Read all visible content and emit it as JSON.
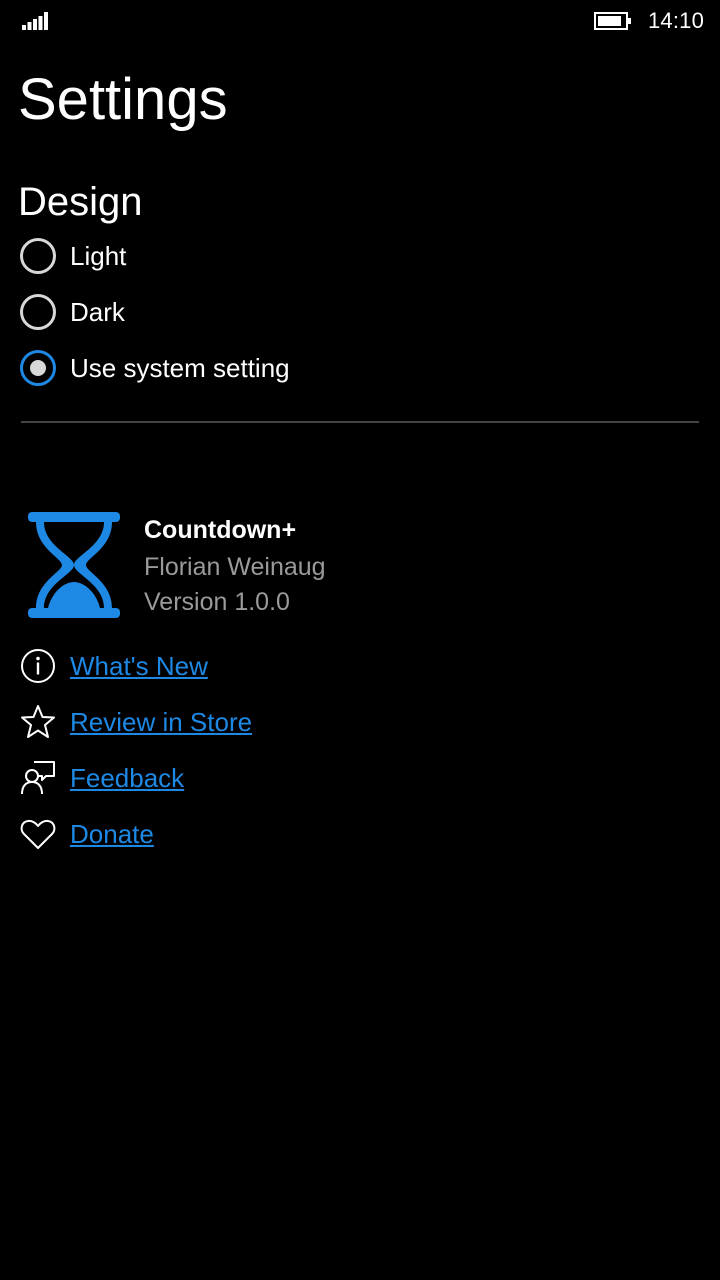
{
  "status_bar": {
    "time": "14:10"
  },
  "page": {
    "title": "Settings"
  },
  "design": {
    "section_title": "Design",
    "options": [
      {
        "label": "Light",
        "selected": false
      },
      {
        "label": "Dark",
        "selected": false
      },
      {
        "label": "Use system setting",
        "selected": true
      }
    ]
  },
  "about": {
    "app_name": "Countdown+",
    "author": "Florian Weinaug",
    "version": "Version 1.0.0"
  },
  "links": [
    {
      "label": "What's New",
      "icon": "info-icon"
    },
    {
      "label": "Review in Store",
      "icon": "star-icon"
    },
    {
      "label": "Feedback",
      "icon": "feedback-icon"
    },
    {
      "label": "Donate",
      "icon": "heart-icon"
    }
  ],
  "colors": {
    "accent": "#1e88e5",
    "background": "#000000",
    "secondary_text": "#9a9a9a"
  }
}
